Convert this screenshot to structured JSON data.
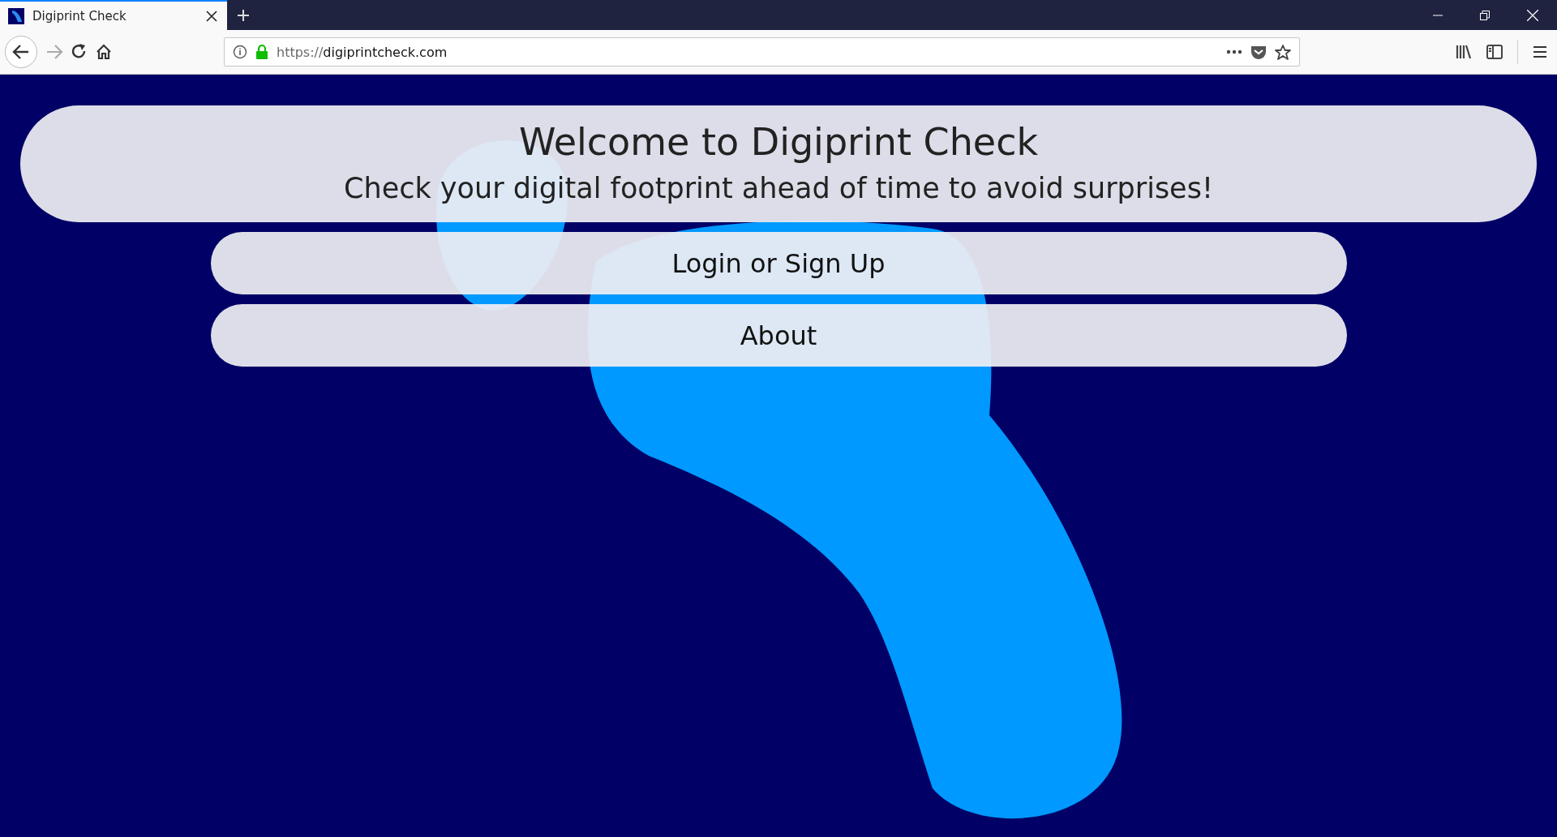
{
  "browser": {
    "tabs": [
      {
        "title": "Digiprint Check",
        "selected": true
      }
    ],
    "url_scheme": "https://",
    "url_host": "digiprintcheck.com"
  },
  "header": {
    "title": "Welcome to Digiprint Check",
    "subtitle": "Check your digital footprint ahead of time to avoid surprises!"
  },
  "buttons": [
    "Login or Sign Up",
    "About"
  ]
}
